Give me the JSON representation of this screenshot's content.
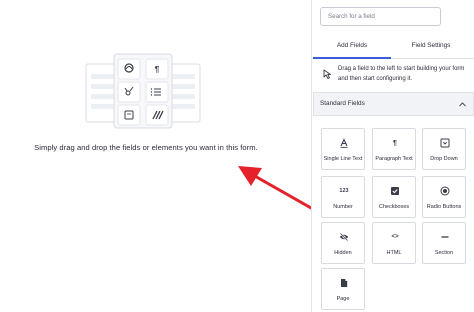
{
  "canvas": {
    "hint": "Simply drag and drop the fields or elements you want in this form."
  },
  "sidebar": {
    "search": {
      "placeholder": "Search for a field",
      "value": ""
    },
    "tabs": [
      {
        "label": "Add Fields",
        "active": true
      },
      {
        "label": "Field Settings",
        "active": false
      }
    ],
    "notice": "Drag a field to the left to start building your form and then start configuring it.",
    "section": {
      "title": "Standard Fields",
      "expanded": true
    },
    "fields": [
      {
        "label": "Single Line Text",
        "icon": "text-a-icon",
        "glyph": "A"
      },
      {
        "label": "Paragraph Text",
        "icon": "paragraph-icon",
        "glyph": "¶"
      },
      {
        "label": "Drop Down",
        "icon": "dropdown-icon"
      },
      {
        "label": "Number",
        "icon": "number-icon",
        "glyph": "123"
      },
      {
        "label": "Checkboxes",
        "icon": "checkbox-icon"
      },
      {
        "label": "Radio Buttons",
        "icon": "radio-icon"
      },
      {
        "label": "Hidden",
        "icon": "eye-slash-icon"
      },
      {
        "label": "HTML",
        "icon": "code-icon",
        "glyph": "<>"
      },
      {
        "label": "Section",
        "icon": "section-line-icon"
      },
      {
        "label": "Page",
        "icon": "page-icon"
      }
    ]
  },
  "colors": {
    "accent": "#3b5bdb",
    "arrow": "#e5222b",
    "panel_bg": "#f1f3f7",
    "border": "#d8dbe2"
  }
}
